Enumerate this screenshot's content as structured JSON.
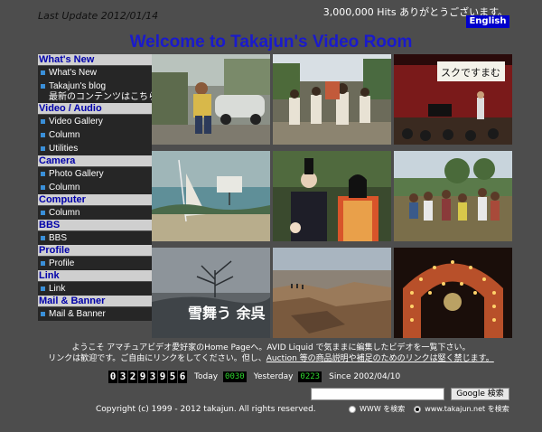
{
  "header": {
    "last_update": "Last Update 2012/01/14",
    "hits": "3,000,000 Hits ありがとうございます。",
    "lang_button": "English",
    "title": "Welcome to Takajun's Video Room"
  },
  "sidebar": {
    "sections": [
      {
        "title": "What's New",
        "items": [
          "What's New",
          "Takajun's blog 最新のコンテンツはこちら"
        ]
      },
      {
        "title": "Video / Audio",
        "items": [
          "Video Gallery",
          "Column",
          "Utilities"
        ]
      },
      {
        "title": "Camera",
        "items": [
          "Photo Gallery",
          "Column"
        ]
      },
      {
        "title": "Computer",
        "items": [
          "Column"
        ]
      },
      {
        "title": "BBS",
        "items": [
          "BBS"
        ]
      },
      {
        "title": "Profile",
        "items": [
          "Profile"
        ]
      },
      {
        "title": "Link",
        "items": [
          "Link"
        ]
      },
      {
        "title": "Mail & Banner",
        "items": [
          "Mail & Banner"
        ]
      }
    ],
    "blog_line1": "Takajun's blog",
    "blog_line2": "最新のコンテンツはこちら"
  },
  "gallery": {
    "thumbs": [
      {
        "name": "man-with-car"
      },
      {
        "name": "street-parade"
      },
      {
        "name": "stage-performance"
      },
      {
        "name": "sailboat-beach"
      },
      {
        "name": "japanese-court-costume"
      },
      {
        "name": "children-field"
      },
      {
        "name": "snowy-tree-title",
        "caption": "雪舞う 余呉"
      },
      {
        "name": "canyon-cliffs"
      },
      {
        "name": "illuminated-arch"
      }
    ]
  },
  "footer": {
    "welcome_line1": "ようこそ アマチュアビデオ愛好家のHome Pageへ。AVID Liquid で気ままに編集したビデオを一覧下さい。",
    "welcome_line2_pre": "リンクは歓迎です。ご自由にリンクをしてください。但し、",
    "welcome_line2_link": "Auction 等の商品説明や補足のためのリンクは堅く禁じます。",
    "counter_digits": [
      "0",
      "3",
      "2",
      "9",
      "3",
      "9",
      "5",
      "6"
    ],
    "today_label": "Today",
    "today_value": "0030",
    "yesterday_label": "Yesterday",
    "yesterday_value": "0223",
    "since": "Since 2002/04/10",
    "search_button": "Google 検索",
    "copyright": "Copyright (c) 1999 - 2012 takajun. All rights reserved.",
    "radio_www": "WWW を検索",
    "radio_site": "www.takajun.net を検索"
  }
}
